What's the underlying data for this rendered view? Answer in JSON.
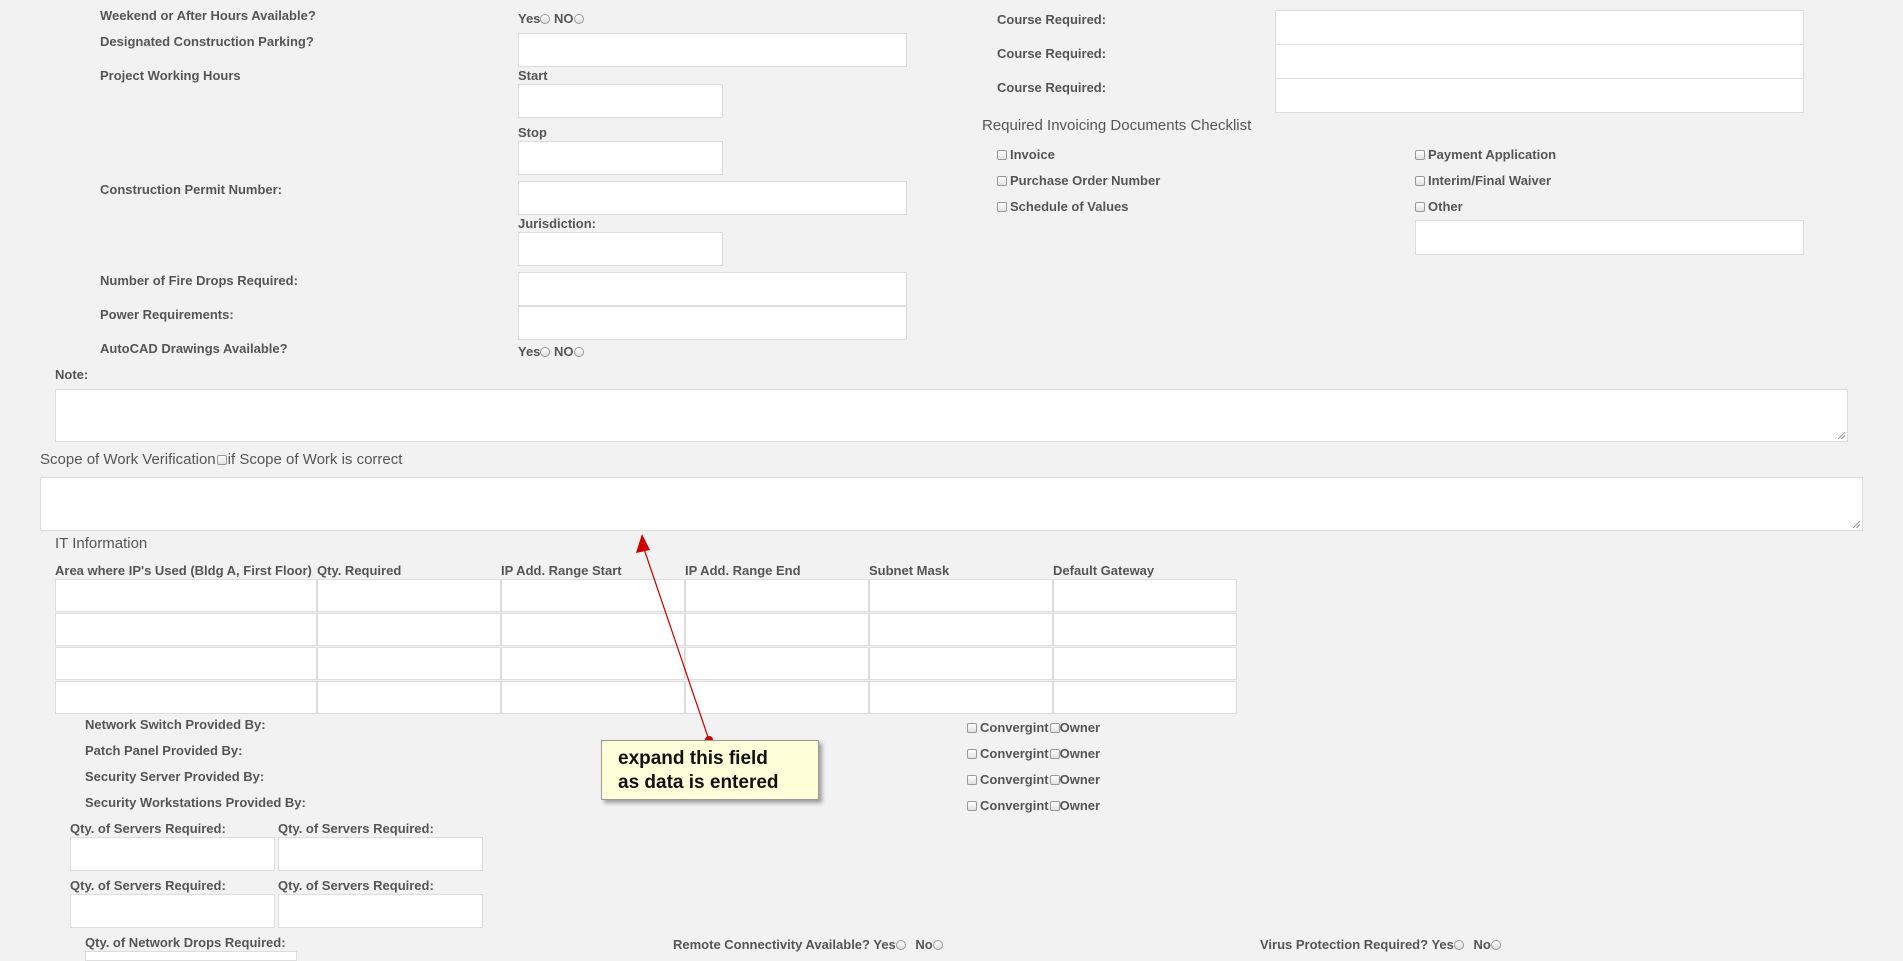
{
  "top_left": {
    "weekend_label": "Weekend or After Hours Available?",
    "weekend_yes": "Yes",
    "weekend_no": "NO",
    "parking_label": "Designated Construction Parking?",
    "hours_label": "Project Working Hours",
    "start_label": "Start",
    "stop_label": "Stop",
    "permit_label": "Construction Permit Number:",
    "jurisdiction_label": "Jurisdiction:",
    "fire_drops_label": "Number of Fire Drops Required:",
    "power_label": "Power Requirements:",
    "autocad_label": "AutoCAD Drawings Available?",
    "autocad_yes": "Yes",
    "autocad_no": "NO"
  },
  "safety": {
    "course_labels": [
      "Course Required:",
      "Course Required:",
      "Course Required:"
    ]
  },
  "invoicing": {
    "title": "Required Invoicing Documents Checklist",
    "left_items": [
      "Invoice",
      "Purchase Order Number",
      "Schedule of Values"
    ],
    "right_items": [
      "Payment Application",
      "Interim/Final Waiver",
      "Other"
    ]
  },
  "note": {
    "label": "Note:"
  },
  "scope": {
    "label_before": "Scope of Work Verification",
    "label_after": "if Scope of Work is correct"
  },
  "it": {
    "title": "IT Information",
    "columns": [
      "Area where IP's Used (Bldg A, First Floor)",
      "Qty. Required",
      "IP Add. Range Start",
      "IP Add. Range End",
      "Subnet Mask",
      "Default Gateway"
    ],
    "row_count_label": "",
    "provided_by": [
      {
        "label": "Network Switch Provided By:",
        "opt1": "Convergint",
        "opt2": "Owner"
      },
      {
        "label": "Patch Panel Provided By:",
        "opt1": "Convergint",
        "opt2": "Owner"
      },
      {
        "label": "Security Server Provided By:",
        "opt1": "Convergint",
        "opt2": "Owner"
      },
      {
        "label": "Security Workstations Provided By:",
        "opt1": "Convergint",
        "opt2": "Owner"
      }
    ],
    "servers_label_1": "Qty. of Servers Required:",
    "servers_label_2": "Qty. of Servers Required:",
    "servers_label_3": "Qty. of Servers Required:",
    "servers_label_4": "Qty. of Servers Required:",
    "network_drops_label": "Qty. of Network Drops Required:",
    "remote_label": "Remote Connectivity Available?",
    "remote_yes": "Yes",
    "remote_no": "No",
    "virus_label": "Virus Protection Required?",
    "virus_yes": "Yes",
    "virus_no": "No"
  },
  "callout": {
    "text": "expand this field\nas data is entered",
    "color": "#cc0000"
  }
}
